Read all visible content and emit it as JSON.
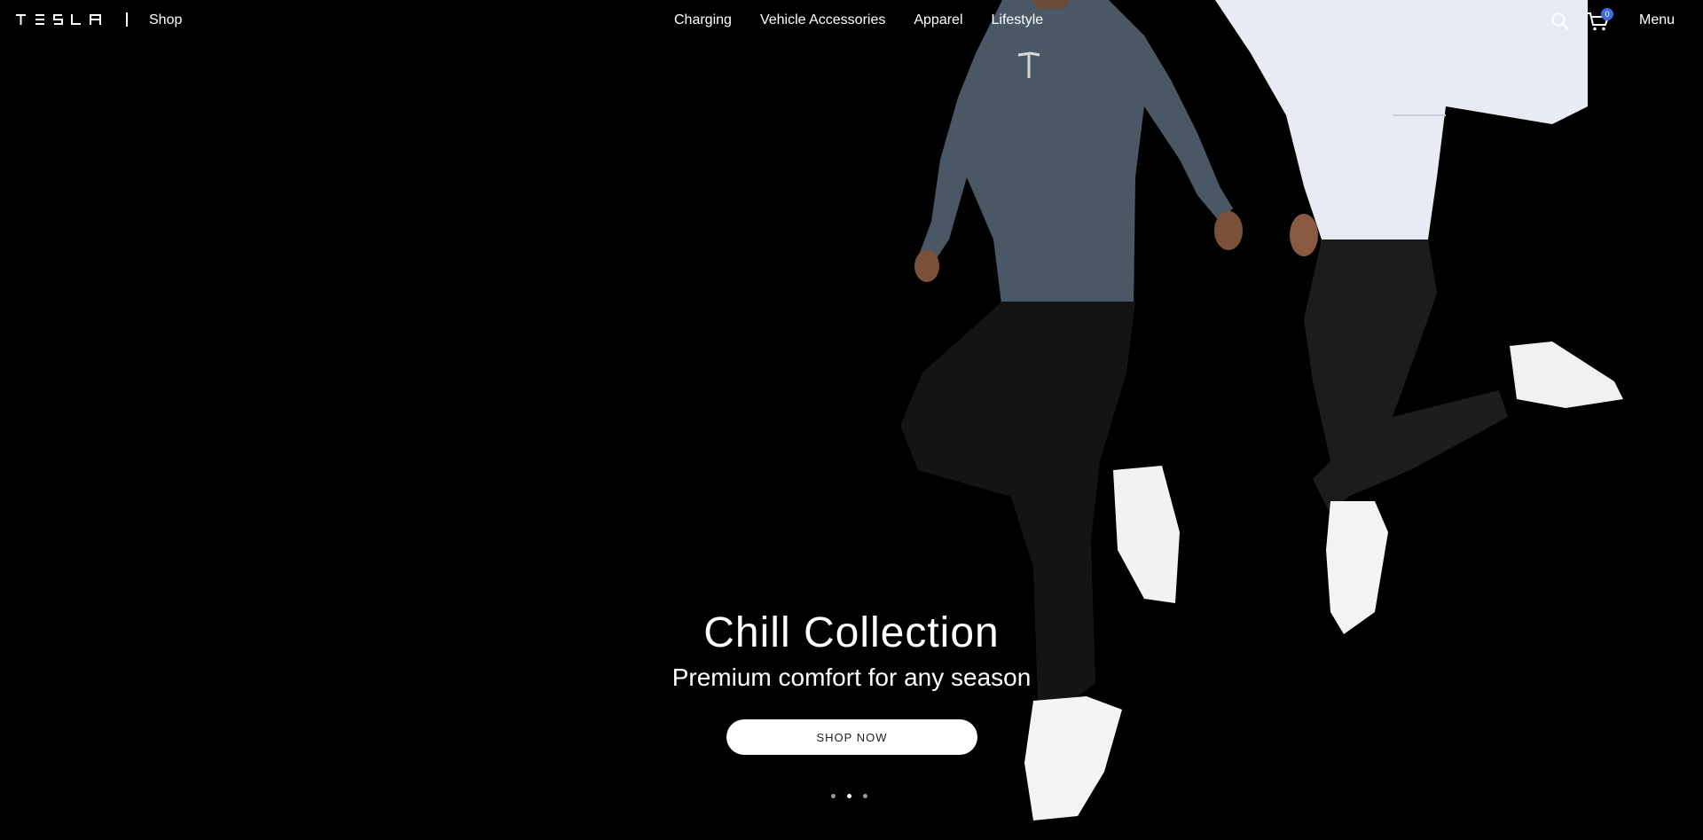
{
  "header": {
    "logo_text": "TESLA",
    "shop_label": "Shop",
    "nav": [
      {
        "label": "Charging"
      },
      {
        "label": "Vehicle Accessories"
      },
      {
        "label": "Apparel"
      },
      {
        "label": "Lifestyle"
      }
    ],
    "search_icon": "search-icon",
    "cart_icon": "cart-icon",
    "cart_count": "0",
    "menu_label": "Menu"
  },
  "hero": {
    "title": "Chill Collection",
    "subtitle": "Premium comfort for any season",
    "cta_label": "SHOP NOW",
    "carousel": {
      "total": 3,
      "active": 2
    }
  },
  "colors": {
    "background": "#000000",
    "text": "#ffffff",
    "badge": "#3e6ae1",
    "button_bg": "#ffffff",
    "button_text": "#222222"
  }
}
